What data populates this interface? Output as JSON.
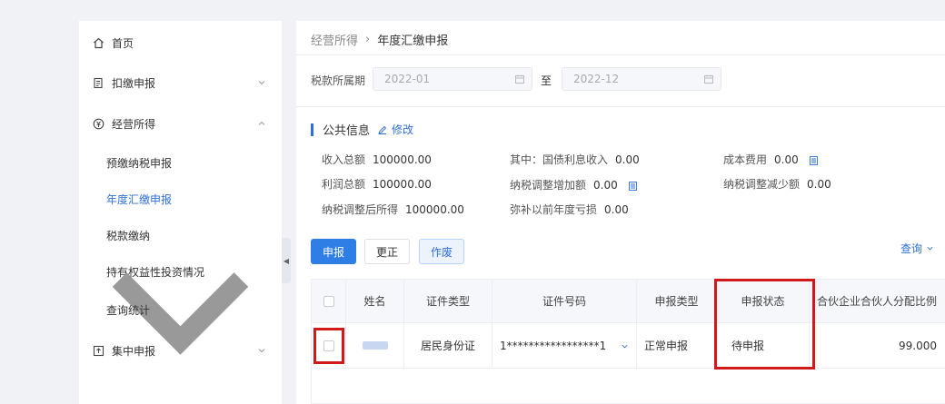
{
  "sidebar": {
    "items": [
      {
        "label": "首页",
        "icon": "home-icon"
      },
      {
        "label": "扣缴申报",
        "icon": "document-list-icon",
        "expanded": false
      },
      {
        "label": "经营所得",
        "icon": "yen-icon",
        "expanded": true
      },
      {
        "label": "集中申报",
        "icon": "upload-box-icon",
        "expanded": false
      }
    ],
    "sub_items": [
      {
        "label": "预缴纳税申报"
      },
      {
        "label": "年度汇缴申报",
        "active": true
      },
      {
        "label": "税款缴纳"
      },
      {
        "label": "持有权益性投资情况"
      },
      {
        "label": "查询统计"
      }
    ]
  },
  "breadcrumb": {
    "parent": "经营所得",
    "separator": "›",
    "current": "年度汇缴申报"
  },
  "filters": {
    "period_label": "税款所属期",
    "start": "2022-01",
    "to_label": "至",
    "end": "2022-12"
  },
  "public_info": {
    "title": "公共信息",
    "edit_label": "修改",
    "fields": {
      "income_total": {
        "label": "收入总额",
        "value": "100000.00"
      },
      "treasury_interest": {
        "label": "其中：国债利息收入",
        "value": "0.00"
      },
      "cost_expense": {
        "label": "成本费用",
        "value": "0.00"
      },
      "profit_total": {
        "label": "利润总额",
        "value": "100000.00"
      },
      "tax_adjust_increase": {
        "label": "纳税调整增加额",
        "value": "0.00"
      },
      "tax_adjust_decrease": {
        "label": "纳税调整减少额",
        "value": "0.00"
      },
      "adjusted_income": {
        "label": "纳税调整后所得",
        "value": "100000.00"
      },
      "loss_offset": {
        "label": "弥补以前年度亏损",
        "value": "0.00"
      }
    }
  },
  "actions": {
    "declare": "申报",
    "correct": "更正",
    "void": "作废",
    "query": "查询"
  },
  "table": {
    "headers": [
      "姓名",
      "证件类型",
      "证件号码",
      "申报类型",
      "申报状态",
      "合伙企业合伙人分配比例"
    ],
    "rows": [
      {
        "id_type": "居民身份证",
        "id_number": "1*****************1",
        "declare_type": "正常申报",
        "status": "待申报",
        "ratio": "99.000"
      }
    ]
  },
  "colors": {
    "accent": "#2f6fd6",
    "highlight": "#d0191a"
  }
}
